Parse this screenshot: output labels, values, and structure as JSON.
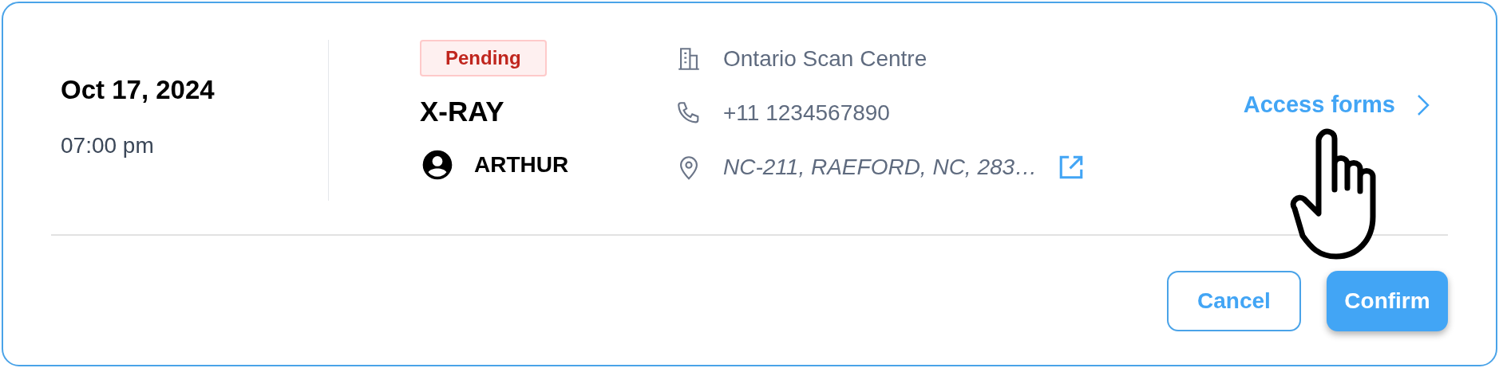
{
  "appointment": {
    "date": "Oct 17, 2024",
    "time": "07:00 pm"
  },
  "status": {
    "label": "Pending"
  },
  "exam": "X-RAY",
  "patient": "ARTHUR",
  "location": [
    {
      "kind": "building",
      "text": "Ontario Scan Centre",
      "italic": false,
      "external_link": false
    },
    {
      "kind": "phone",
      "text": "+11 1234567890",
      "italic": false,
      "external_link": false
    },
    {
      "kind": "address",
      "text": "NC-211, RAEFORD, NC, 283…",
      "italic": true,
      "external_link": true
    }
  ],
  "link": {
    "label": "Access forms"
  },
  "buttons": [
    {
      "kind": "outline",
      "label": "Cancel"
    },
    {
      "kind": "primary",
      "label": "Confirm"
    }
  ]
}
